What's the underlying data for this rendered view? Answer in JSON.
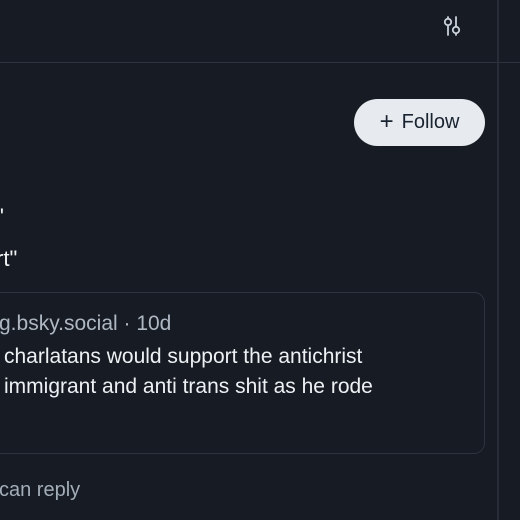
{
  "top_bar": {
    "filter_icon": "sliders-icon"
  },
  "post": {
    "follow_label": "Follow",
    "follow_icon": "plus-icon",
    "text_line_1": "\"",
    "text_line_2": "rt\""
  },
  "quote": {
    "meta": "g.bsky.social · 10d",
    "line_1": "charlatans would support the antichrist",
    "line_2": "immigrant and anti trans shit as he rode"
  },
  "reply_note": "can reply",
  "colors": {
    "background": "#171c24",
    "follow_button_bg": "#e7ebef",
    "border": "#2c3440"
  }
}
